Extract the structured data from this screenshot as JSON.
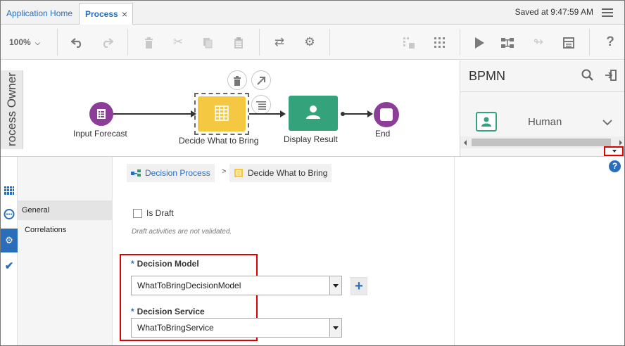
{
  "tabs": [
    {
      "label": "Application Home"
    },
    {
      "label": "Process",
      "close": "×"
    }
  ],
  "status": {
    "saved_text": "Saved at 9:47:59 AM"
  },
  "toolbar": {
    "zoom": "100%"
  },
  "canvas": {
    "lane_label": "rocess Owner",
    "nodes": [
      {
        "label": "Input Forecast"
      },
      {
        "label": "Decide What to Bring"
      },
      {
        "label": "Display Result"
      },
      {
        "label": "End"
      }
    ]
  },
  "palette": {
    "title": "BPMN",
    "item_label": "Human"
  },
  "breadcrumb": {
    "process": "Decision Process",
    "separator": ">",
    "activity": "Decide What to Bring"
  },
  "nav": {
    "items": [
      {
        "label": "General"
      },
      {
        "label": "Correlations"
      }
    ]
  },
  "form": {
    "is_draft_label": "Is Draft",
    "is_draft_checked": false,
    "draft_hint": "Draft activities are not validated.",
    "decision_model": {
      "required_mark": "*",
      "label": "Decision Model",
      "value": "WhatToBringDecisionModel"
    },
    "decision_service": {
      "required_mark": "*",
      "label": "Decision Service",
      "value": "WhatToBringService"
    },
    "add_button": "+"
  },
  "help_button": "?",
  "colors": {
    "accent": "#2a6ebb",
    "start_event": "#8b3d97",
    "decision_task": "#f5c842",
    "human_task": "#34a37b",
    "highlight": "#dd0000"
  }
}
